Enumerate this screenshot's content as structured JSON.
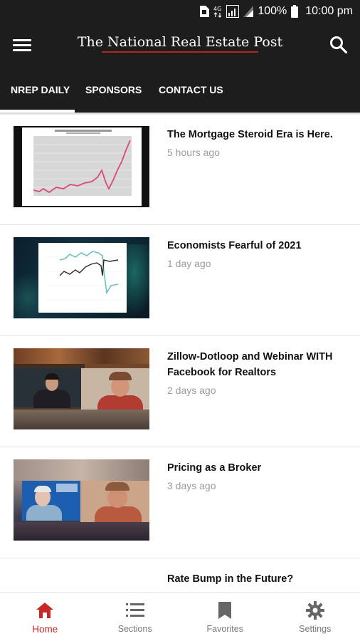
{
  "status_bar": {
    "battery": "100%",
    "time": "10:00 pm",
    "network": "4G"
  },
  "app_bar": {
    "title": "The National Real Estate Post"
  },
  "tabs": [
    {
      "label": "NREP DAILY",
      "active": true
    },
    {
      "label": "SPONSORS",
      "active": false
    },
    {
      "label": "CONTACT US",
      "active": false
    }
  ],
  "articles": [
    {
      "title": "The Mortgage Steroid Era is Here.",
      "time": "5 hours ago"
    },
    {
      "title": "Economists Fearful of 2021",
      "time": "1 day ago"
    },
    {
      "title": "Zillow-Dotloop and Webinar WITH Facebook for Realtors",
      "time": "2 days ago"
    },
    {
      "title": "Pricing as a Broker",
      "time": "3 days ago"
    },
    {
      "title": "Rate Bump in the Future?",
      "time": ""
    }
  ],
  "bottom_nav": [
    {
      "label": "Home",
      "icon": "home-icon",
      "active": true
    },
    {
      "label": "Sections",
      "icon": "list-icon",
      "active": false
    },
    {
      "label": "Favorites",
      "icon": "bookmark-icon",
      "active": false
    },
    {
      "label": "Settings",
      "icon": "gear-icon",
      "active": false
    }
  ],
  "colors": {
    "app_bar_bg": "#1d1d1d",
    "accent": "#c62828",
    "time_gray": "#9b9b9b"
  }
}
